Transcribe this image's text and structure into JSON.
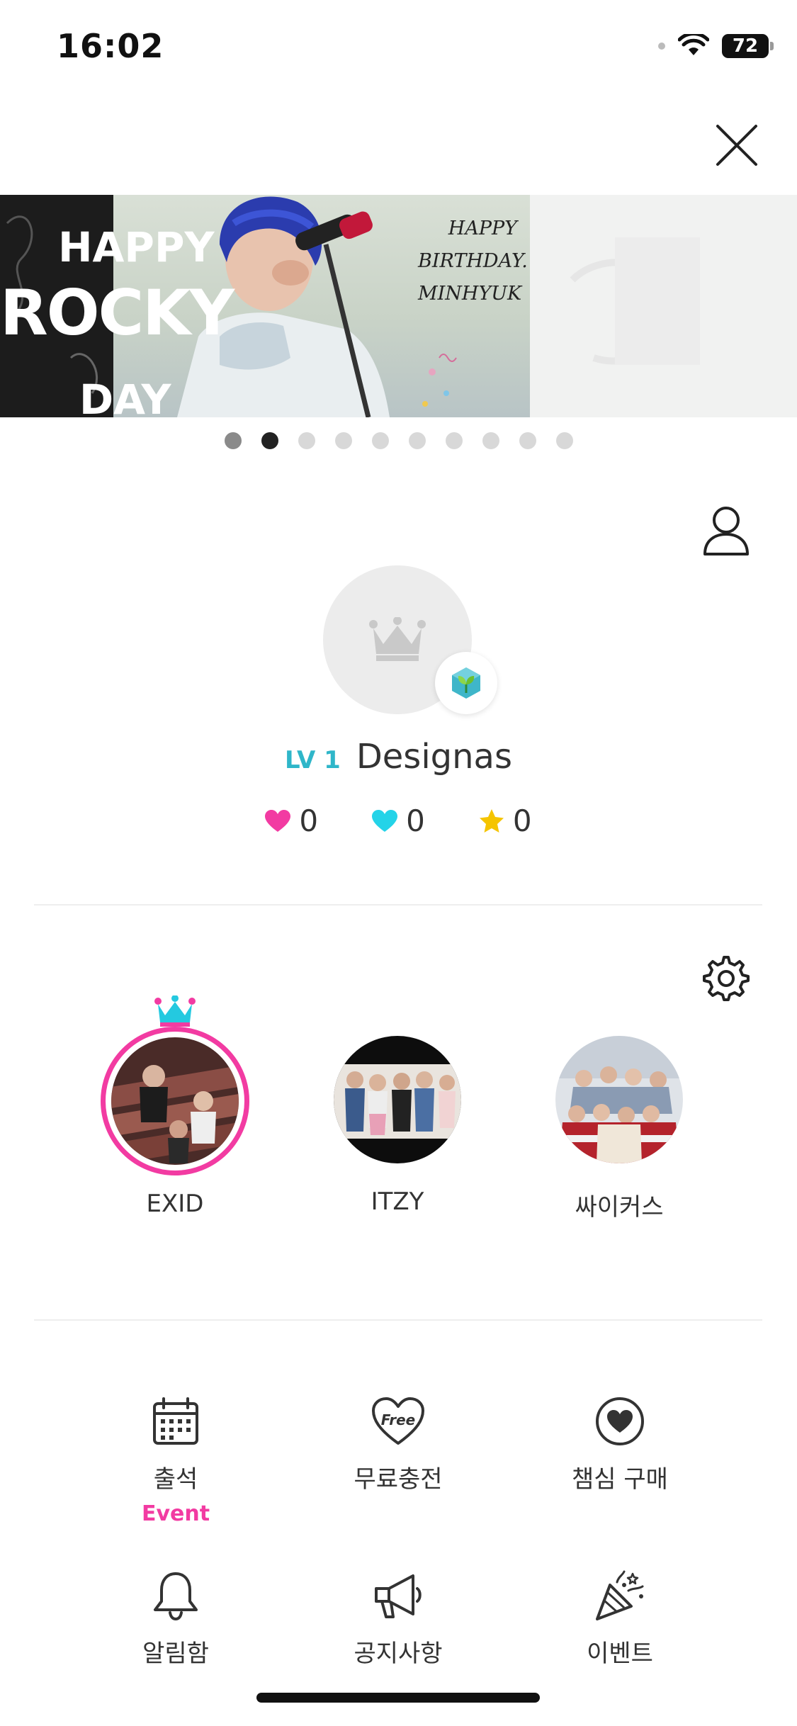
{
  "status_bar": {
    "time": "16:02",
    "battery": "72"
  },
  "banner": {
    "left_text": [
      "HAPPY",
      "ROCKY",
      "DAY"
    ],
    "script_text": [
      "HAPPY",
      "BIRTHDAY.",
      "MINHYUK"
    ],
    "page_count": 10,
    "active_index": 1
  },
  "profile": {
    "level_label": "LV 1",
    "username": "Designas",
    "pink_hearts": "0",
    "blue_hearts": "0",
    "stars": "0"
  },
  "artists": [
    {
      "name": "EXID",
      "selected": true
    },
    {
      "name": "ITZY",
      "selected": false
    },
    {
      "name": "싸이커스",
      "selected": false
    }
  ],
  "menu": {
    "attendance": {
      "label": "출석",
      "sub": "Event",
      "icon": "calendar-icon"
    },
    "free_charge": {
      "label": "무료충전",
      "icon_text": "Free",
      "icon": "free-heart-icon"
    },
    "buy_hearts": {
      "label": "챔심 구매",
      "icon": "heart-circle-icon"
    },
    "notifications": {
      "label": "알림함",
      "icon": "bell-icon"
    },
    "notices": {
      "label": "공지사항",
      "icon": "megaphone-icon"
    },
    "events": {
      "label": "이벤트",
      "icon": "party-popper-icon"
    }
  },
  "colors": {
    "accent_pink": "#f23ba2",
    "accent_cyan": "#2fb6c9",
    "star": "#f5c400"
  }
}
